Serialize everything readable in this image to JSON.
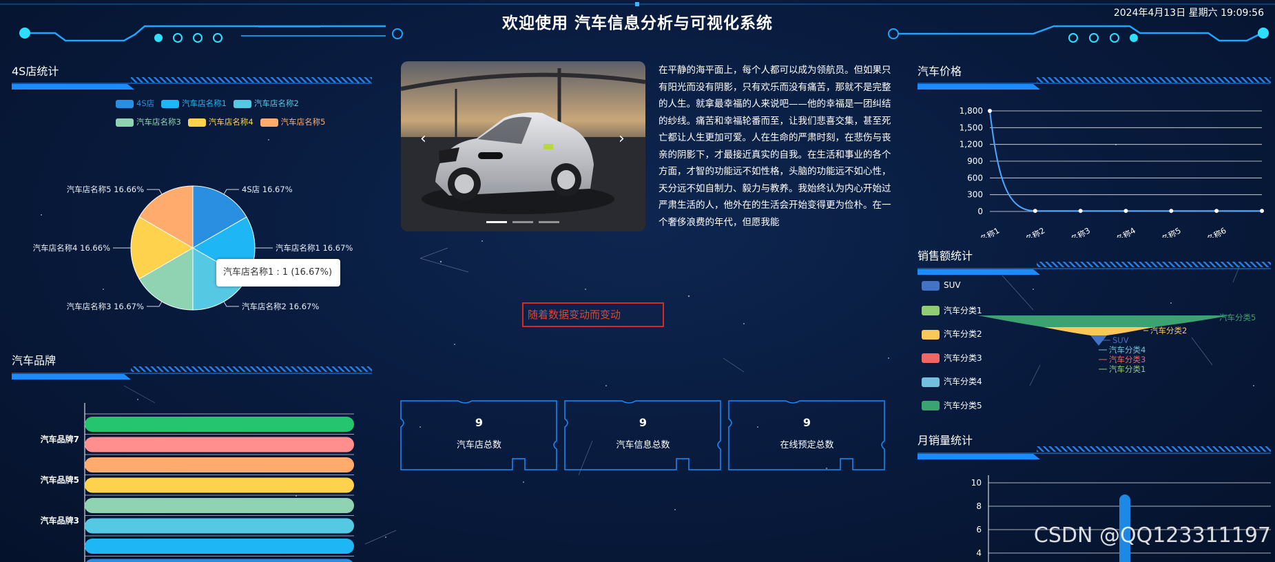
{
  "header": {
    "title": "欢迎使用 汽车信息分析与可视化系统",
    "datetime": "2024年4月13日 星期六 19:09:56"
  },
  "sections": {
    "store_stats": "4S店统计",
    "car_brand": "汽车品牌",
    "car_price": "汽车价格",
    "sales_stats": "销售额统计",
    "monthly_sales": "月销量统计"
  },
  "article": {
    "text": "在平静的海平面上，每个人都可以成为领航员。但如果只有阳光而没有阴影，只有欢乐而没有痛苦，那就不是完整的人生。就拿最幸福的人来说吧——他的幸福是一团纠结的纱线。痛苦和幸福轮番而至，让我们悲喜交集，甚至死亡都让人生更加可爱。人在生命的严肃时刻，在悲伤与丧亲的阴影下，才最接近真实的自我。在生活和事业的各个方面，才智的功能远不如性格，头脑的功能远不如心性，天分远不如自制力、毅力与教养。我始终认为内心开始过严肃生活的人，他外在的生活会开始变得更为俭朴。在一个奢侈浪费的年代，但愿我能"
  },
  "carousel": {
    "prev": "‹",
    "next": "›"
  },
  "change_box": {
    "text": "随着数据变动而变动"
  },
  "stats": [
    {
      "value": "9",
      "label": "汽车店总数"
    },
    {
      "value": "9",
      "label": "汽车信息总数"
    },
    {
      "value": "9",
      "label": "在线预定总数"
    }
  ],
  "colors": {
    "accent": "#1a9bff",
    "title_bar": "#1e88e5"
  },
  "chart_data": [
    {
      "type": "pie",
      "categories": [
        "4S店",
        "汽车店名称1",
        "汽车店名称2",
        "汽车店名称3",
        "汽车店名称4",
        "汽车店名称5"
      ],
      "values": [
        16.67,
        16.67,
        16.67,
        16.67,
        16.66,
        16.66
      ],
      "value_labels": [
        "4S店 16.67%",
        "汽车店名称1 16.67%",
        "汽车店名称2 16.67%",
        "汽车店名称3 16.67%",
        "汽车店名称4 16.66%",
        "汽车店名称5 16.66%"
      ],
      "colors": [
        "#2a8fe0",
        "#1fb6f5",
        "#55c8e4",
        "#8fd3b3",
        "#ffd24d",
        "#ffab6e"
      ],
      "legend_placement": "top",
      "tooltip": "汽车店名称1 : 1 (16.67%)"
    },
    {
      "type": "bar",
      "orientation": "horizontal",
      "categories": [
        "汽车品牌7",
        "汽车品牌5",
        "汽车品牌3"
      ],
      "bar_colors": [
        "#25c46e",
        "#ff8e8e",
        "#ffab6e",
        "#ffd24d",
        "#8fd3b3",
        "#55c8e4",
        "#1fb6f5",
        "#2a8fe0"
      ],
      "bar_count_visible": 8
    },
    {
      "type": "line",
      "categories": [
        "汽车名称1",
        "汽车名称2",
        "汽车名称3",
        "汽车名称4",
        "汽车名称5",
        "汽车名称6",
        ""
      ],
      "values": [
        1800,
        10,
        10,
        10,
        10,
        10,
        10
      ],
      "ylim": [
        0,
        1800
      ],
      "yticks": [
        "0",
        "300",
        "600",
        "900",
        "1,200",
        "1,500",
        "1,800"
      ],
      "grid": true
    },
    {
      "type": "funnel",
      "legend": [
        "SUV",
        "汽车分类1",
        "汽车分类2",
        "汽车分类3",
        "汽车分类4",
        "汽车分类5"
      ],
      "colors": [
        "#4472c4",
        "#91cc75",
        "#fac858",
        "#ee6666",
        "#73c0de",
        "#3ba272"
      ],
      "labels": [
        "汽车分类5",
        "汽车分类2",
        "SUV",
        "汽车分类4",
        "汽车分类3",
        "汽车分类1"
      ]
    },
    {
      "type": "bar",
      "ylim": [
        0,
        10
      ],
      "yticks": [
        "4",
        "6",
        "8",
        "10"
      ],
      "grid": true,
      "bar_color": "#1e88e5"
    }
  ],
  "watermark": "CSDN @QQ123311197"
}
